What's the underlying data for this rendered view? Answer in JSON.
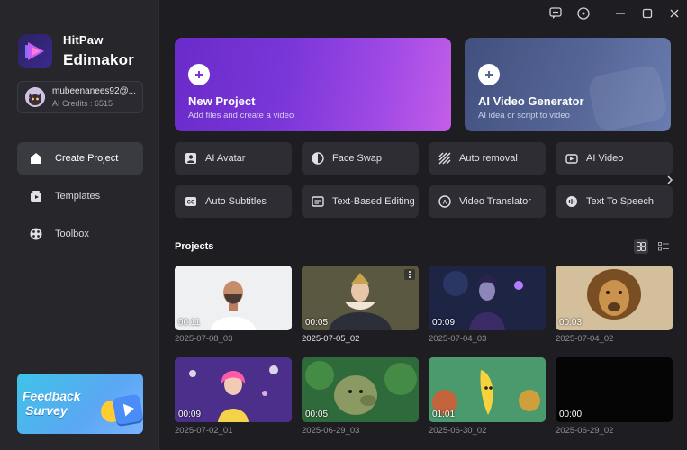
{
  "app": {
    "brand_line1": "HitPaw",
    "brand_line2": "Edimakor"
  },
  "account": {
    "name": "mubeenanees92@...",
    "credits": "AI Credits : 6515"
  },
  "sidebar": {
    "items": [
      {
        "label": "Create Project",
        "icon": "home-icon",
        "active": true
      },
      {
        "label": "Templates",
        "icon": "templates-icon",
        "active": false
      },
      {
        "label": "Toolbox",
        "icon": "toolbox-icon",
        "active": false
      }
    ],
    "feedback_banner": {
      "line1": "Feedback",
      "line2": "Survey"
    }
  },
  "hero": {
    "new_project": {
      "title": "New Project",
      "subtitle": "Add files and create a video"
    },
    "ai_video_generator": {
      "title": "AI Video Generator",
      "subtitle": "AI idea or script to video"
    }
  },
  "features": [
    {
      "label": "AI Avatar",
      "icon": "avatar-icon"
    },
    {
      "label": "Face Swap",
      "icon": "face-swap-icon"
    },
    {
      "label": "Auto removal",
      "icon": "auto-removal-icon"
    },
    {
      "label": "AI Video",
      "icon": "ai-video-icon"
    },
    {
      "label": "Auto Subtitles",
      "icon": "subtitles-icon"
    },
    {
      "label": "Text-Based Editing",
      "icon": "text-editing-icon"
    },
    {
      "label": "Video Translator",
      "icon": "translator-icon"
    },
    {
      "label": "Text To Speech",
      "icon": "text-to-speech-icon"
    }
  ],
  "projects": {
    "title": "Projects",
    "items": [
      {
        "name": "2025-07-08_03",
        "duration": "00:11",
        "theme": "portrait-white"
      },
      {
        "name": "2025-07-05_02",
        "duration": "00:05",
        "theme": "painting-queen"
      },
      {
        "name": "2025-07-04_03",
        "duration": "00:09",
        "theme": "fantasy-purple"
      },
      {
        "name": "2025-07-04_02",
        "duration": "00:03",
        "theme": "lion"
      },
      {
        "name": "2025-07-02_01",
        "duration": "00:09",
        "theme": "stage-pink"
      },
      {
        "name": "2025-06-29_03",
        "duration": "00:05",
        "theme": "jungle-troll"
      },
      {
        "name": "2025-06-30_02",
        "duration": "01:01",
        "theme": "banana-jungle"
      },
      {
        "name": "2025-06-29_02",
        "duration": "00:00",
        "theme": "black"
      }
    ]
  },
  "colors": {
    "accent": "#7a36d8",
    "background": "#1e1e22",
    "sidebar": "#26262b"
  }
}
